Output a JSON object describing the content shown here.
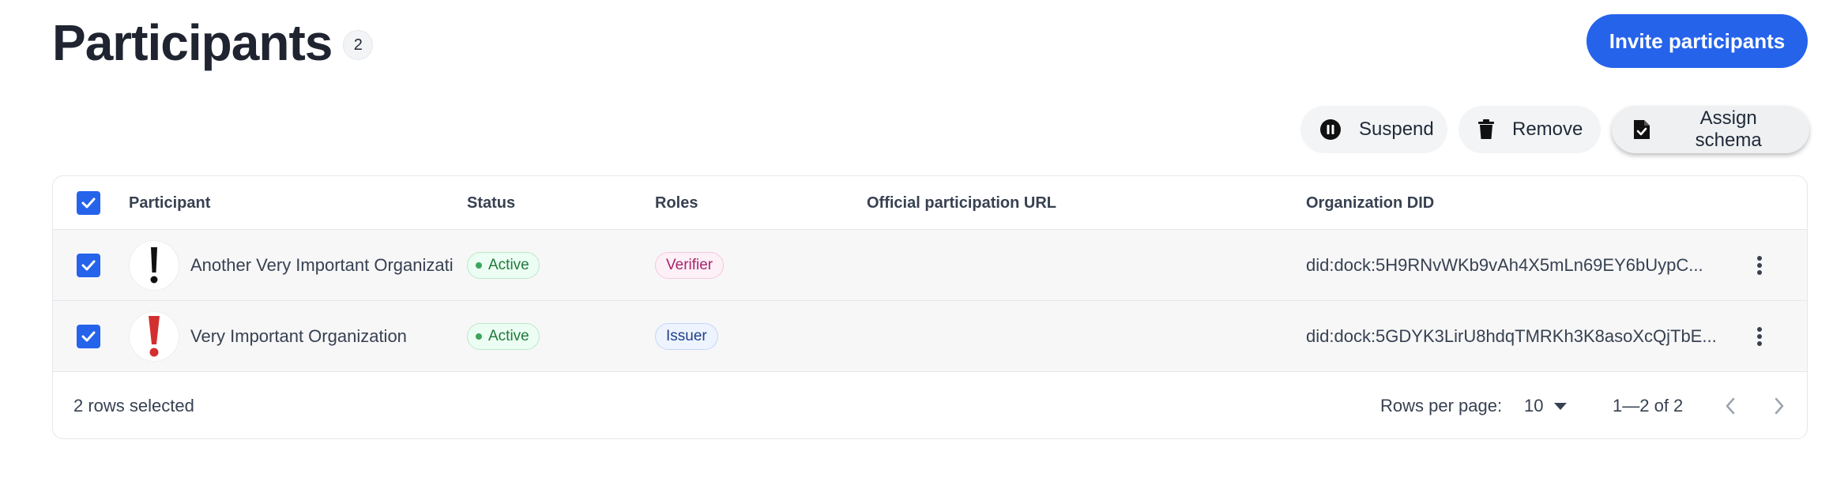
{
  "header": {
    "title": "Participants",
    "count": "2",
    "invite_label": "Invite participants"
  },
  "toolbar": {
    "suspend_label": "Suspend",
    "remove_label": "Remove",
    "assign_label": "Assign schema"
  },
  "table": {
    "columns": {
      "participant": "Participant",
      "status": "Status",
      "roles": "Roles",
      "url": "Official participation URL",
      "did": "Organization DID"
    },
    "rows": [
      {
        "name": "Another Very Important Organizati",
        "status": "Active",
        "role": "Verifier",
        "url": "",
        "did": "did:dock:5H9RNvWKb9vAh4X5mLn69EY6bUypC...",
        "avatar_icon": "black-exclamation-icon"
      },
      {
        "name": "Very Important Organization",
        "status": "Active",
        "role": "Issuer",
        "url": "",
        "did": "did:dock:5GDYK3LirU8hdqTMRKh3K8asoXcQjTbE...",
        "avatar_icon": "red-exclamation-icon"
      }
    ]
  },
  "footer": {
    "selected_text": "2 rows selected",
    "rows_per_page_label": "Rows per page:",
    "rows_per_page_value": "10",
    "range_text": "1—2 of 2"
  },
  "colors": {
    "primary": "#2563eb",
    "active_green": "#1f7a3a",
    "verifier_pink": "#a8246b",
    "issuer_blue": "#1e3f8a",
    "warning_red": "#d32f2f"
  }
}
